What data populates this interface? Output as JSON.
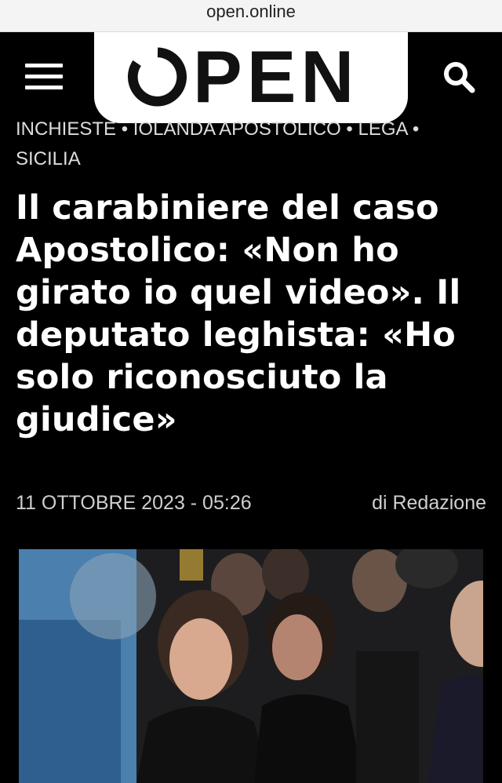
{
  "browser": {
    "url": "open.online"
  },
  "header": {
    "logo_text": "PEN",
    "menu_icon": "hamburger-menu-icon",
    "search_icon": "search-icon",
    "logo_bg": "#ffffff"
  },
  "tags": {
    "items": [
      "Inchieste",
      "Iolanda Apostolico",
      "Lega",
      "Sicilia"
    ],
    "separator": "•"
  },
  "article": {
    "headline": "Il carabiniere del caso Apostolico: «Non ho girato io quel video». Il deputato leghista: «Ho solo riconosciuto la giudice»",
    "date": "11 OTTOBRE 2023 - 05:26",
    "author": "di Redazione"
  },
  "colors": {
    "background": "#000000",
    "text": "#ffffff",
    "muted": "#cfcfcf"
  }
}
